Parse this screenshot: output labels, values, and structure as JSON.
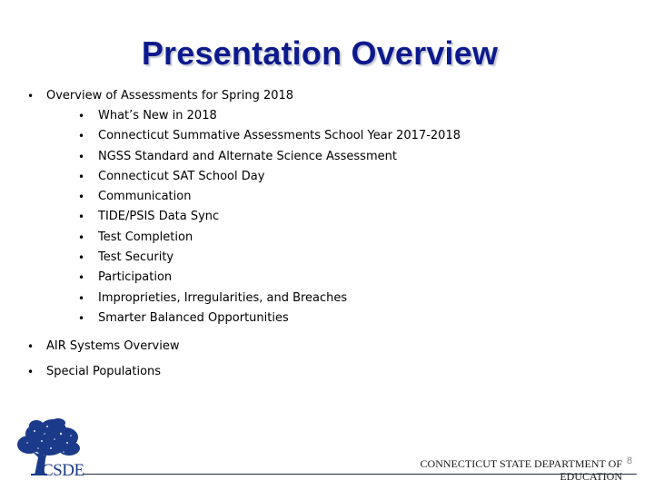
{
  "slide": {
    "title": "Presentation Overview",
    "bullets": [
      {
        "text": "Overview of Assessments for Spring 2018",
        "children": [
          "What’s New in 2018",
          "Connecticut Summative Assessments School Year 2017-2018",
          "NGSS Standard and Alternate Science Assessment",
          "Connecticut SAT School Day",
          "Communication",
          "TIDE/PSIS Data Sync",
          "Test Completion",
          "Test Security",
          "Participation",
          "Improprieties, Irregularities, and Breaches",
          "Smarter Balanced Opportunities"
        ]
      },
      {
        "text": "AIR Systems Overview",
        "children": []
      },
      {
        "text": "Special Populations",
        "children": []
      }
    ],
    "bullet_glyph": "•"
  },
  "footer": {
    "logo_text": "CSDE",
    "logo_icon": "tree-icon",
    "organization": "CONNECTICUT STATE DEPARTMENT OF EDUCATION",
    "organization_line1": "CONNECTICUT STATE DEPARTMENT OF",
    "organization_line2": "EDUCATION",
    "page_number": "8"
  },
  "colors": {
    "title": "#0d1a8c",
    "logo": "#1b3a8a",
    "footer_line": "#1e2a3a",
    "page_number": "#8a8a8a"
  }
}
